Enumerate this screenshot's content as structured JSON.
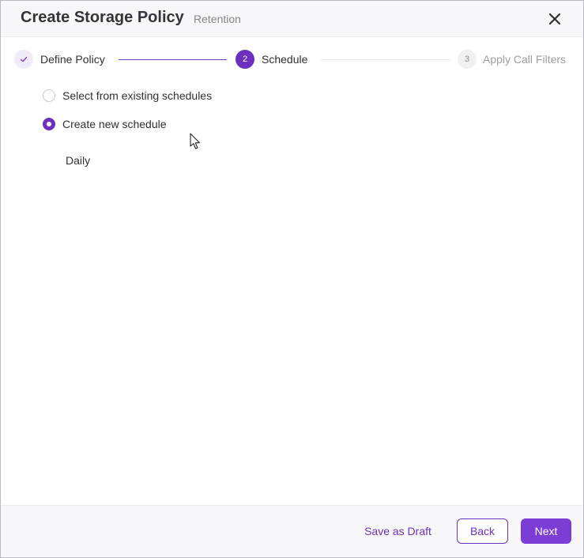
{
  "dialog": {
    "title": "Create Storage Policy",
    "subtitle": "Retention",
    "close_icon": "close-icon"
  },
  "stepper": {
    "steps": [
      {
        "number": "1",
        "label": "Define Policy",
        "status": "completed",
        "icon": "check-icon"
      },
      {
        "number": "2",
        "label": "Schedule",
        "status": "active"
      },
      {
        "number": "3",
        "label": "Apply Call Filters",
        "status": "upcoming"
      }
    ]
  },
  "schedule": {
    "options": [
      {
        "label": "Select from existing schedules",
        "selected": false
      },
      {
        "label": "Create new schedule",
        "selected": true
      }
    ],
    "frequency": "Daily"
  },
  "footer": {
    "save_draft_label": "Save as Draft",
    "back_label": "Back",
    "next_label": "Next"
  },
  "colors": {
    "accent": "#6d2fbf",
    "primary_button": "#7c3cd6",
    "header_bg": "#f7f7f9",
    "text": "#2f2f35",
    "muted_text": "#86868e"
  }
}
